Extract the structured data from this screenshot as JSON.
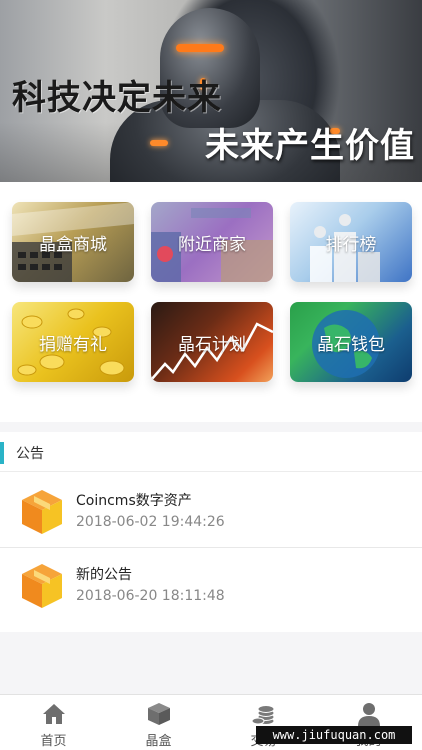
{
  "banner": {
    "headline_1": "科技决定未来",
    "headline_2": "未来产生价值"
  },
  "grid": {
    "tiles": [
      {
        "label": "晶盒商城"
      },
      {
        "label": "附近商家"
      },
      {
        "label": "排行榜"
      },
      {
        "label": "捐赠有礼"
      },
      {
        "label": "晶石计划"
      },
      {
        "label": "晶石钱包"
      }
    ]
  },
  "notices": {
    "title": "公告",
    "items": [
      {
        "name": "Coincms数字资产",
        "date": "2018-06-02 19:44:26",
        "icon": "cube-icon"
      },
      {
        "name": "新的公告",
        "date": "2018-06-20 18:11:48",
        "icon": "cube-icon"
      }
    ]
  },
  "tabbar": {
    "tabs": [
      {
        "label": "首页",
        "icon": "home-icon"
      },
      {
        "label": "晶盒",
        "icon": "box-icon"
      },
      {
        "label": "交易",
        "icon": "coins-icon"
      },
      {
        "label": "我的",
        "icon": "user-icon"
      }
    ]
  },
  "watermark": "www.jiufuquan.com",
  "colors": {
    "accent": "#2ab3c7",
    "cube_orange": "#f08a1e",
    "cube_yellow": "#f6c324"
  }
}
